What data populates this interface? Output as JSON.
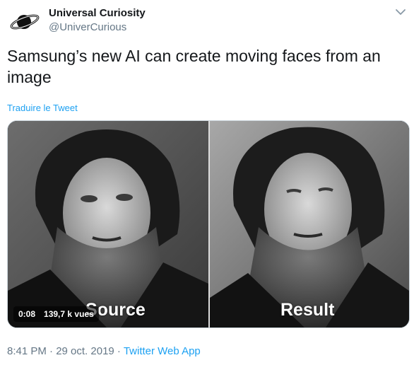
{
  "author": {
    "display_name": "Universal Curiosity",
    "handle": "@UniverCurious"
  },
  "tweet": {
    "text": "Samsung’s new AI can create moving faces from an image",
    "translate_label": "Traduire le Tweet"
  },
  "video": {
    "left_label": "Source",
    "right_label": "Result",
    "duration": "0:08",
    "views": "139,7 k vues"
  },
  "meta": {
    "timestamp": "8:41 PM · 29 oct. 2019 ·",
    "client": "Twitter Web App"
  },
  "colors": {
    "link": "#1da1f2",
    "secondary_text": "#657786",
    "primary_text": "#14171a",
    "border": "#ccd6dd"
  },
  "icons": {
    "avatar": "planet-logo",
    "menu": "chevron-down-icon"
  }
}
